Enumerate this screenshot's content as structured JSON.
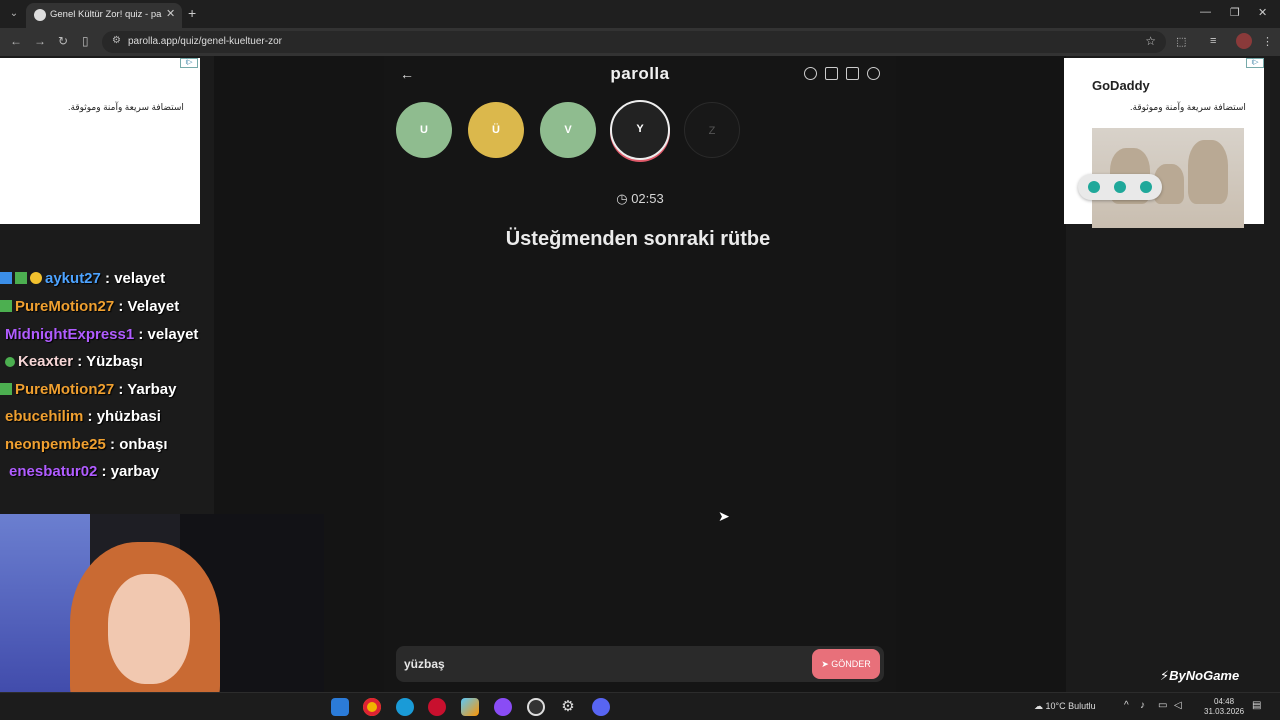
{
  "browser": {
    "tab_title": "Genel Kültür Zor! quiz - parolla",
    "tab_close": "✕",
    "new_tab": "+",
    "url": "parolla.app/quiz/genel-kueltuer-zor"
  },
  "ads": {
    "left_text": "استضافة سريعة وآمنة وموثوقة.",
    "right_brand": "GoDaddy",
    "right_text": "استضافة سريعة وآمنة وموثوقة."
  },
  "game": {
    "brand": "parolla",
    "letters": [
      {
        "char": "U",
        "state": "correct"
      },
      {
        "char": "Ü",
        "state": "skipped"
      },
      {
        "char": "V",
        "state": "correct"
      },
      {
        "char": "Y",
        "state": "current"
      },
      {
        "char": "Z",
        "state": "pending"
      }
    ],
    "timer": "02:53",
    "question": "Üsteğmenden sonraki rütbe",
    "answer_value": "yüzbaş",
    "send_label": "GÖNDER"
  },
  "chat": [
    {
      "user": "aykut27",
      "message": "velayet",
      "color": "#4da3ff"
    },
    {
      "user": "PureMotion27",
      "message": "Velayet",
      "color": "#f0a030"
    },
    {
      "user": "MidnightExpress1",
      "message": "velayet",
      "color": "#b05cff"
    },
    {
      "user": "Keaxter",
      "message": "Yüzbaşı",
      "color": "#f6d6d6"
    },
    {
      "user": "PureMotion27",
      "message": "Yarbay",
      "color": "#f0a030"
    },
    {
      "user": "ebucehilim",
      "message": "yhüzbasi",
      "color": "#f0a030"
    },
    {
      "user": "neonpembe25",
      "message": "onbaşı",
      "color": "#f0a030"
    },
    {
      "user": "enesbatur02",
      "message": "yarbay",
      "color": "#b05cff"
    }
  ],
  "watermark": "ByNoGame",
  "taskbar": {
    "weather": "10°C Bulutlu",
    "time": "04:48",
    "date": "31.03.2026"
  }
}
